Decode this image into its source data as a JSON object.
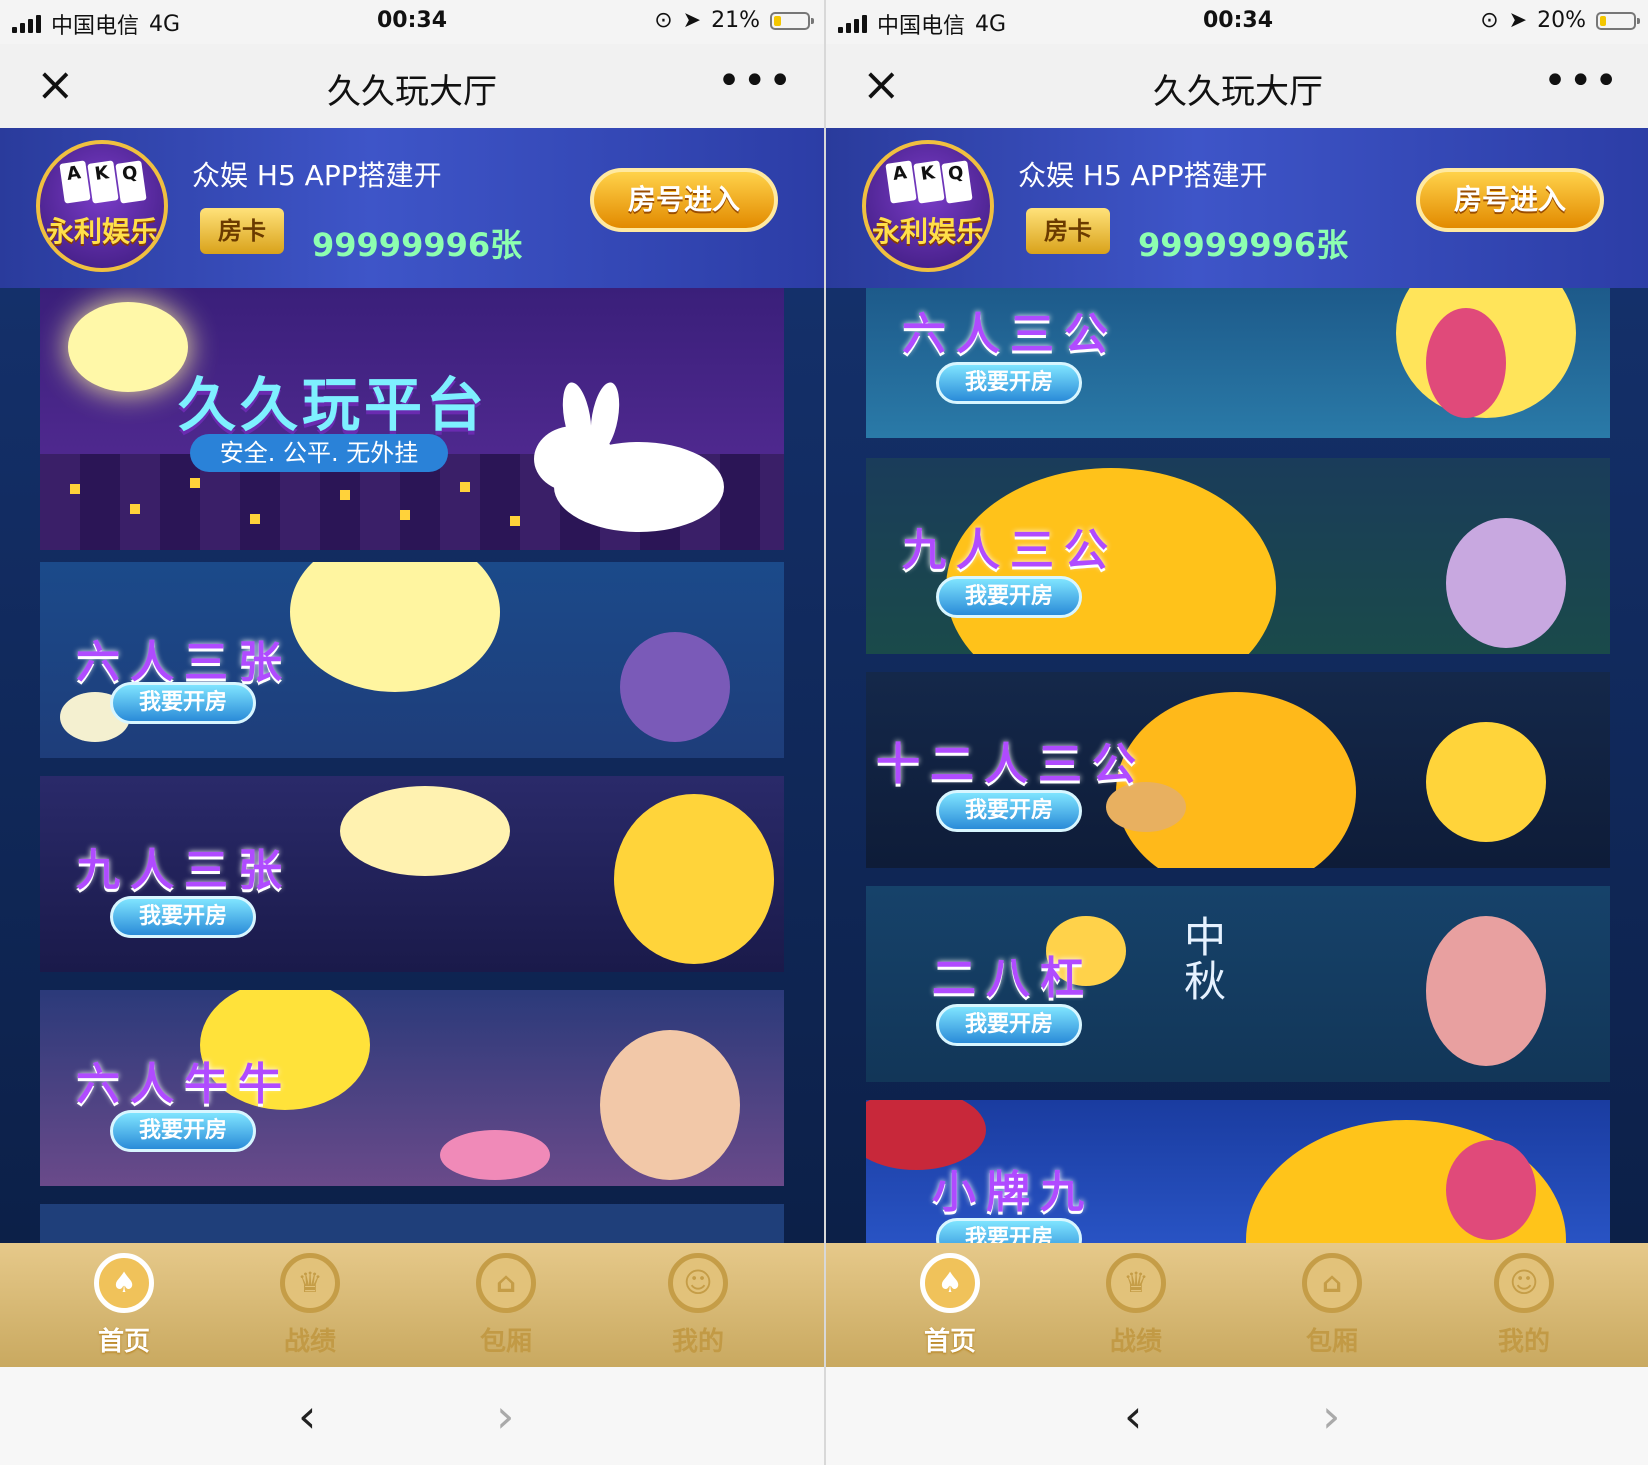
{
  "screens": [
    {
      "status": {
        "carrier": "中国电信",
        "network": "4G",
        "time": "00:34",
        "battery": "21%",
        "battery_level": 0.21
      },
      "nav": {
        "title": "久久玩大厅",
        "close": "×",
        "more": "•••"
      },
      "header": {
        "shop_title": "众娱 H5 APP搭建开",
        "card_tag": "房卡",
        "card_count": "99999996张",
        "enter_button": "房号进入",
        "avatar_logo": "永利娱乐"
      },
      "hero": {
        "title": "久久玩平台",
        "subtitle": "安全. 公平. 无外挂"
      },
      "games": [
        {
          "name": "六人三张",
          "open_label": "我要开房"
        },
        {
          "name": "九人三张",
          "open_label": "我要开房"
        },
        {
          "name": "六人牛牛",
          "open_label": "我要开房"
        }
      ],
      "tabs": [
        {
          "label": "首页",
          "icon": "spade-icon",
          "active": true
        },
        {
          "label": "战绩",
          "icon": "trophy-icon",
          "active": false
        },
        {
          "label": "包厢",
          "icon": "home-icon",
          "active": false
        },
        {
          "label": "我的",
          "icon": "user-icon",
          "active": false
        }
      ],
      "browser": {
        "back": "‹",
        "forward": "›"
      }
    },
    {
      "status": {
        "carrier": "中国电信",
        "network": "4G",
        "time": "00:34",
        "battery": "20%",
        "battery_level": 0.2
      },
      "nav": {
        "title": "久久玩大厅",
        "close": "×",
        "more": "•••"
      },
      "header": {
        "shop_title": "众娱 H5 APP搭建开",
        "card_tag": "房卡",
        "card_count": "99999996张",
        "enter_button": "房号进入",
        "avatar_logo": "永利娱乐"
      },
      "games": [
        {
          "name": "六人三公",
          "open_label": "我要开房"
        },
        {
          "name": "九人三公",
          "open_label": "我要开房"
        },
        {
          "name": "十二人三公",
          "open_label": "我要开房"
        },
        {
          "name": "二八杠",
          "open_label": "我要开房",
          "extra": "中秋"
        },
        {
          "name": "小牌九",
          "open_label": "我要开房"
        }
      ],
      "tabs": [
        {
          "label": "首页",
          "icon": "spade-icon",
          "active": true
        },
        {
          "label": "战绩",
          "icon": "trophy-icon",
          "active": false
        },
        {
          "label": "包厢",
          "icon": "home-icon",
          "active": false
        },
        {
          "label": "我的",
          "icon": "user-icon",
          "active": false
        }
      ],
      "browser": {
        "back": "‹",
        "forward": "›"
      }
    }
  ],
  "colors": {
    "header_blue": "#3e55c8",
    "tab_gold": "#c9a960",
    "card_count_green": "#8dffb0",
    "title_purple": "#b04bff"
  }
}
